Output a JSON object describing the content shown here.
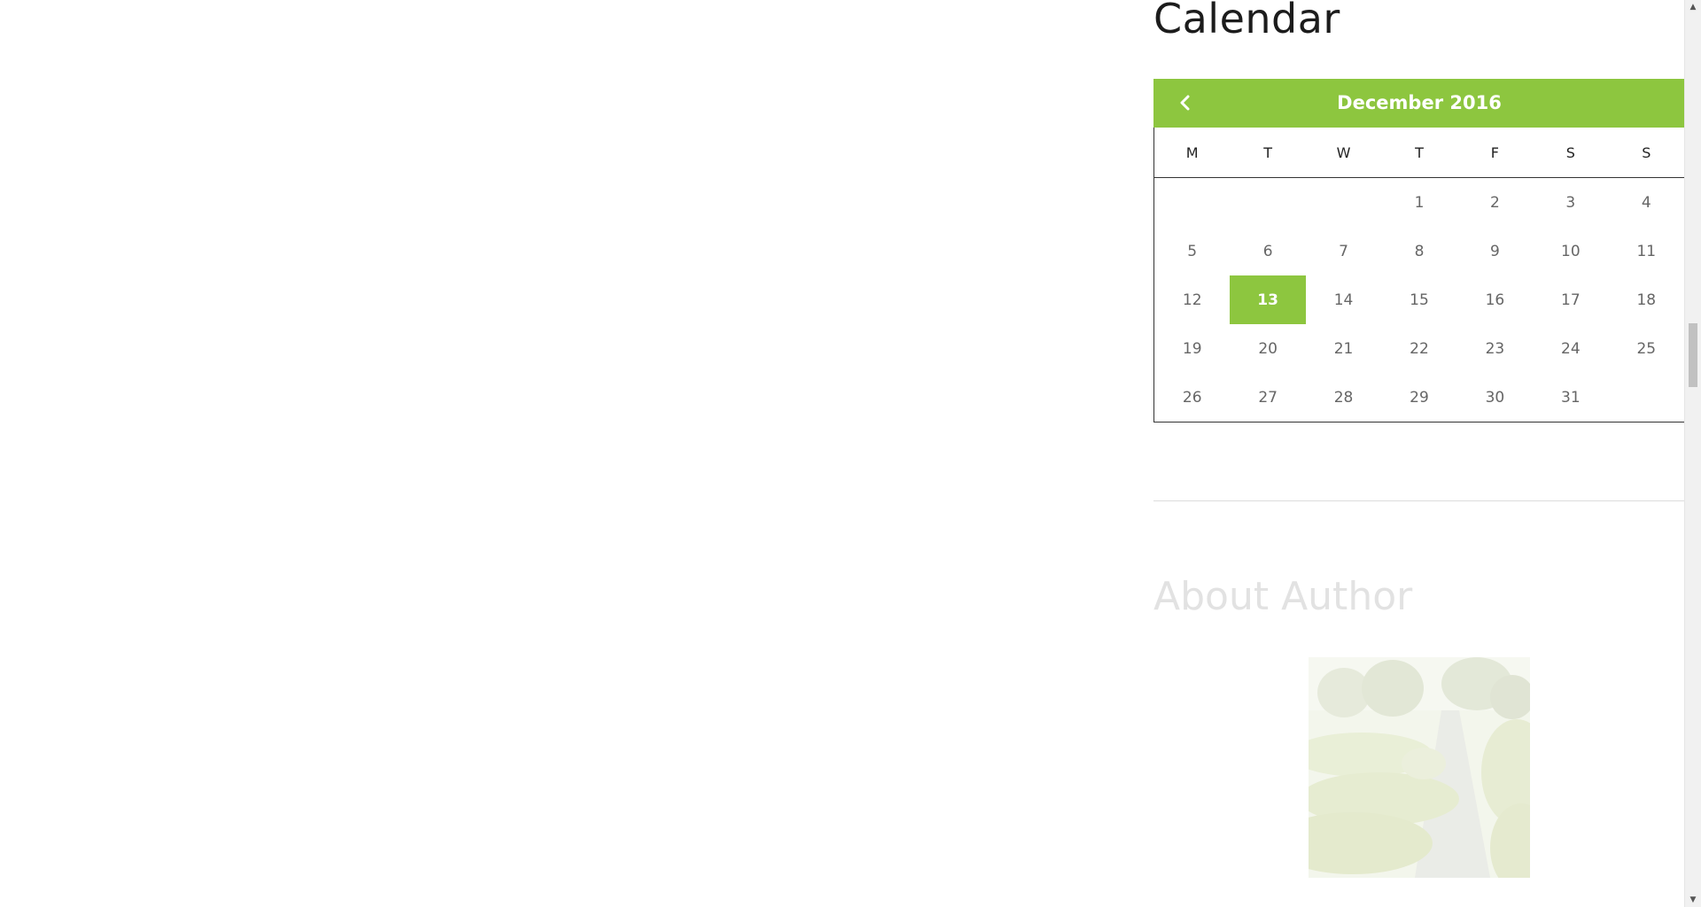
{
  "sidebar": {
    "calendar_heading": "Calendar",
    "about_heading": "About Author"
  },
  "calendar": {
    "month_title": "December 2016",
    "prev_icon": "chevron-left-icon",
    "weekdays": [
      "M",
      "T",
      "W",
      "T",
      "F",
      "S",
      "S"
    ],
    "weeks": [
      [
        "",
        "",
        "",
        "1",
        "2",
        "3",
        "4"
      ],
      [
        "5",
        "6",
        "7",
        "8",
        "9",
        "10",
        "11"
      ],
      [
        "12",
        "13",
        "14",
        "15",
        "16",
        "17",
        "18"
      ],
      [
        "19",
        "20",
        "21",
        "22",
        "23",
        "24",
        "25"
      ],
      [
        "26",
        "27",
        "28",
        "29",
        "30",
        "31",
        ""
      ]
    ],
    "today": "13",
    "accent_color": "#8dc63f"
  }
}
